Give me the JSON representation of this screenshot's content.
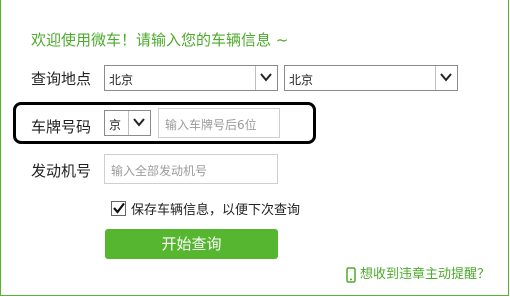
{
  "welcome": "欢迎使用微车！请输入您的车辆信息 ~",
  "location": {
    "label": "查询地点",
    "province": "北京",
    "city": "北京"
  },
  "plate": {
    "label": "车牌号码",
    "prefix": "京",
    "placeholder": "输入车牌号后6位"
  },
  "engine": {
    "label": "发动机号",
    "placeholder": "输入全部发动机号"
  },
  "save": {
    "label": "保存车辆信息，以便下次查询",
    "checked": true
  },
  "submit": "开始查询",
  "reminder": "想收到违章主动提醒？",
  "colors": {
    "accent": "#56b630",
    "text_green": "#4daa2c"
  }
}
